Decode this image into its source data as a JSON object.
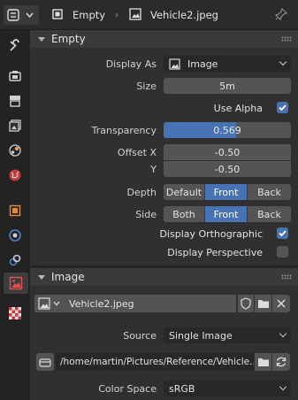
{
  "header": {
    "object_name": "Empty",
    "data_name": "Vehicle2.jpeg"
  },
  "empty_panel": {
    "title": "Empty",
    "display_as_label": "Display As",
    "display_as_value": "Image",
    "size_label": "Size",
    "size_value": "5m",
    "use_alpha_label": "Use Alpha",
    "use_alpha_checked": true,
    "transparency_label": "Transparency",
    "transparency_value": "0.569",
    "transparency_fraction": 0.569,
    "offset_x_label": "Offset X",
    "offset_x_value": "-0.50",
    "offset_y_label": "Y",
    "offset_y_value": "-0.50",
    "depth_label": "Depth",
    "depth_options": [
      "Default",
      "Front",
      "Back"
    ],
    "depth_selected": "Front",
    "side_label": "Side",
    "side_options": [
      "Both",
      "Front",
      "Back"
    ],
    "side_selected": "Front",
    "display_orthographic_label": "Display Orthographic",
    "display_orthographic_checked": true,
    "display_perspective_label": "Display Perspective",
    "display_perspective_checked": false
  },
  "image_panel": {
    "title": "Image",
    "image_name": "Vehicle2.jpeg",
    "source_label": "Source",
    "source_value": "Single Image",
    "filepath": "/home/martin/Pictures/Reference/Vehicle..",
    "color_space_label": "Color Space",
    "color_space_value": "sRGB"
  },
  "tabs": [
    "tool",
    "render",
    "output",
    "view-layer",
    "scene",
    "world",
    "object",
    "physics",
    "constraints",
    "data",
    "texture"
  ],
  "colors": {
    "accent": "#4772b3",
    "background": "#303030",
    "panel_header": "#3a3a3a",
    "field": "#545454",
    "dropdown": "#282828"
  }
}
